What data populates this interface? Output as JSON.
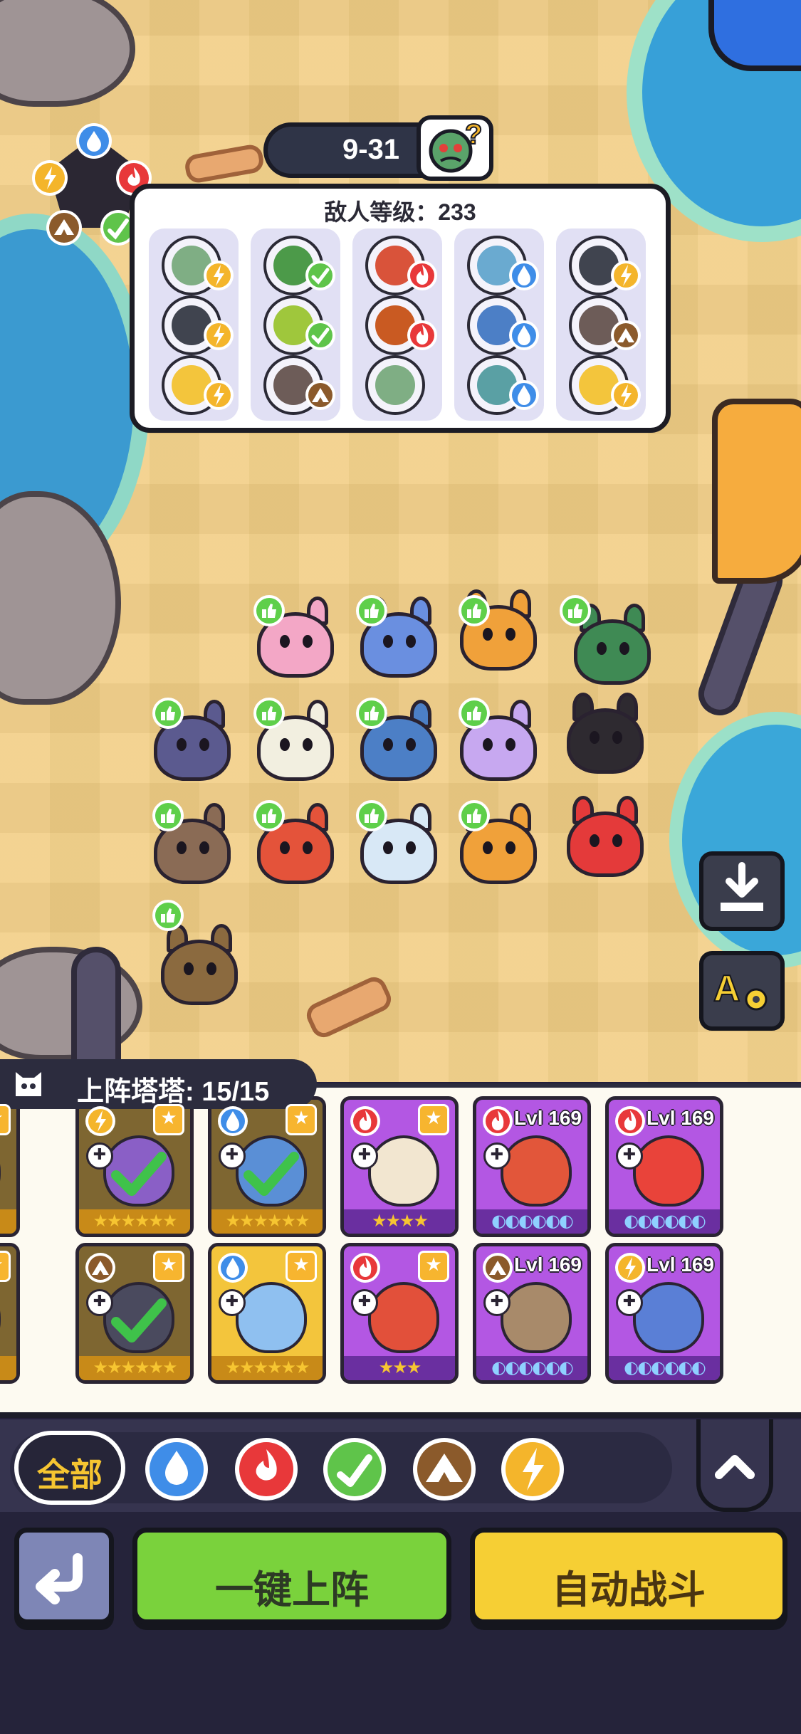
{
  "stage": {
    "label": "9-31",
    "boss_icon": "mystery-zombie-icon"
  },
  "enemy_panel": {
    "level_text": "敌人等级：233",
    "columns": [
      {
        "slots": [
          {
            "monster": "green-zombie",
            "element": "lightning"
          },
          {
            "monster": "ninja-ghoul",
            "element": "lightning"
          },
          {
            "monster": "yellow-fish",
            "element": "lightning"
          }
        ]
      },
      {
        "slots": [
          {
            "monster": "leaf-zombie",
            "element": "leaf"
          },
          {
            "monster": "leaf-blob",
            "element": "leaf"
          },
          {
            "monster": "rock-crab",
            "element": "rock"
          }
        ]
      },
      {
        "slots": [
          {
            "monster": "fire-zombie",
            "element": "fire"
          },
          {
            "monster": "lava-mask",
            "element": "fire"
          },
          {
            "monster": "green-zombie",
            "element": "none"
          }
        ]
      },
      {
        "slots": [
          {
            "monster": "water-zombie",
            "element": "water"
          },
          {
            "monster": "water-hat",
            "element": "water"
          },
          {
            "monster": "blue-zombie",
            "element": "water"
          }
        ]
      },
      {
        "slots": [
          {
            "monster": "ninja-ghoul",
            "element": "lightning"
          },
          {
            "monster": "rock-crab",
            "element": "rock"
          },
          {
            "monster": "yellow-fish",
            "element": "lightning"
          }
        ]
      }
    ]
  },
  "element_wheel": [
    "water",
    "fire",
    "leaf",
    "rock",
    "lightning"
  ],
  "roster": {
    "title": "上阵塔塔: 15/15",
    "row1": [
      {
        "element": "rock",
        "tier": "gold",
        "dim": true,
        "stars": "★★",
        "deployed": false
      },
      {
        "element": "lightning",
        "tier": "gold",
        "dim": true,
        "stars": "★★★★★★",
        "deployed": true
      },
      {
        "element": "water",
        "tier": "gold",
        "dim": true,
        "stars": "★★★★★★",
        "deployed": true
      },
      {
        "element": "fire",
        "tier": "purple",
        "dim": false,
        "stars": "★★★★",
        "level": "",
        "deployed": false
      },
      {
        "element": "fire",
        "tier": "purple",
        "dim": false,
        "stars": "◐◐◐◐◐◐",
        "level": "Lvl 169",
        "deployed": false
      },
      {
        "element": "fire",
        "tier": "purple",
        "dim": false,
        "stars": "◐◐◐◐◐◐",
        "level": "Lvl 169",
        "deployed": false
      }
    ],
    "row2": [
      {
        "element": "rock",
        "tier": "gold",
        "dim": true,
        "stars": "★★",
        "deployed": false
      },
      {
        "element": "rock",
        "tier": "gold",
        "dim": true,
        "stars": "★★★★★★",
        "deployed": true
      },
      {
        "element": "water",
        "tier": "gold",
        "dim": false,
        "stars": "★★★★★★",
        "deployed": false
      },
      {
        "element": "fire",
        "tier": "purple",
        "dim": false,
        "stars": "★★★",
        "level": "",
        "deployed": false
      },
      {
        "element": "rock",
        "tier": "purple",
        "dim": false,
        "stars": "◐◐◐◐◐◐",
        "level": "Lvl 169",
        "deployed": false
      },
      {
        "element": "lightning",
        "tier": "purple",
        "dim": false,
        "stars": "◐◐◐◐◐◐",
        "level": "Lvl 169",
        "deployed": false
      }
    ]
  },
  "filters": {
    "all_label": "全部",
    "elements": [
      "water-drop-icon",
      "fire-icon",
      "leaf-icon",
      "mountain-icon",
      "lightning-icon"
    ]
  },
  "actions": {
    "back_icon": "return-arrow-icon",
    "deploy_label": "一键上阵",
    "auto_label": "自动战斗"
  },
  "side_buttons": [
    "download-icon",
    "auto-settings-icon"
  ],
  "colors": {
    "water": "#3f8de8",
    "fire": "#e8383a",
    "leaf": "#5fc44a",
    "rock": "#8b5a2b",
    "lightning": "#f4b52b",
    "sand": "#f2cf86",
    "card_purple": "#b357e3",
    "card_gold": "#f3c53c",
    "deploy_green": "#7ad23c",
    "auto_yellow": "#f6cf34"
  }
}
